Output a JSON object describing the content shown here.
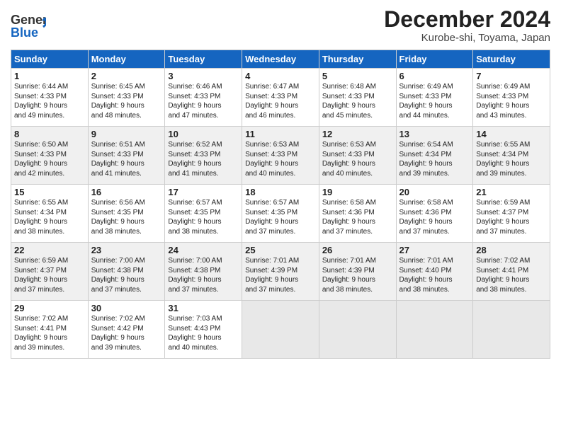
{
  "header": {
    "logo_general": "General",
    "logo_blue": "Blue",
    "title": "December 2024",
    "subtitle": "Kurobe-shi, Toyama, Japan"
  },
  "days_of_week": [
    "Sunday",
    "Monday",
    "Tuesday",
    "Wednesday",
    "Thursday",
    "Friday",
    "Saturday"
  ],
  "weeks": [
    [
      {
        "day": "1",
        "sunrise": "Sunrise: 6:44 AM",
        "sunset": "Sunset: 4:33 PM",
        "daylight": "Daylight: 9 hours and 49 minutes."
      },
      {
        "day": "2",
        "sunrise": "Sunrise: 6:45 AM",
        "sunset": "Sunset: 4:33 PM",
        "daylight": "Daylight: 9 hours and 48 minutes."
      },
      {
        "day": "3",
        "sunrise": "Sunrise: 6:46 AM",
        "sunset": "Sunset: 4:33 PM",
        "daylight": "Daylight: 9 hours and 47 minutes."
      },
      {
        "day": "4",
        "sunrise": "Sunrise: 6:47 AM",
        "sunset": "Sunset: 4:33 PM",
        "daylight": "Daylight: 9 hours and 46 minutes."
      },
      {
        "day": "5",
        "sunrise": "Sunrise: 6:48 AM",
        "sunset": "Sunset: 4:33 PM",
        "daylight": "Daylight: 9 hours and 45 minutes."
      },
      {
        "day": "6",
        "sunrise": "Sunrise: 6:49 AM",
        "sunset": "Sunset: 4:33 PM",
        "daylight": "Daylight: 9 hours and 44 minutes."
      },
      {
        "day": "7",
        "sunrise": "Sunrise: 6:49 AM",
        "sunset": "Sunset: 4:33 PM",
        "daylight": "Daylight: 9 hours and 43 minutes."
      }
    ],
    [
      {
        "day": "8",
        "sunrise": "Sunrise: 6:50 AM",
        "sunset": "Sunset: 4:33 PM",
        "daylight": "Daylight: 9 hours and 42 minutes."
      },
      {
        "day": "9",
        "sunrise": "Sunrise: 6:51 AM",
        "sunset": "Sunset: 4:33 PM",
        "daylight": "Daylight: 9 hours and 41 minutes."
      },
      {
        "day": "10",
        "sunrise": "Sunrise: 6:52 AM",
        "sunset": "Sunset: 4:33 PM",
        "daylight": "Daylight: 9 hours and 41 minutes."
      },
      {
        "day": "11",
        "sunrise": "Sunrise: 6:53 AM",
        "sunset": "Sunset: 4:33 PM",
        "daylight": "Daylight: 9 hours and 40 minutes."
      },
      {
        "day": "12",
        "sunrise": "Sunrise: 6:53 AM",
        "sunset": "Sunset: 4:33 PM",
        "daylight": "Daylight: 9 hours and 40 minutes."
      },
      {
        "day": "13",
        "sunrise": "Sunrise: 6:54 AM",
        "sunset": "Sunset: 4:34 PM",
        "daylight": "Daylight: 9 hours and 39 minutes."
      },
      {
        "day": "14",
        "sunrise": "Sunrise: 6:55 AM",
        "sunset": "Sunset: 4:34 PM",
        "daylight": "Daylight: 9 hours and 39 minutes."
      }
    ],
    [
      {
        "day": "15",
        "sunrise": "Sunrise: 6:55 AM",
        "sunset": "Sunset: 4:34 PM",
        "daylight": "Daylight: 9 hours and 38 minutes."
      },
      {
        "day": "16",
        "sunrise": "Sunrise: 6:56 AM",
        "sunset": "Sunset: 4:35 PM",
        "daylight": "Daylight: 9 hours and 38 minutes."
      },
      {
        "day": "17",
        "sunrise": "Sunrise: 6:57 AM",
        "sunset": "Sunset: 4:35 PM",
        "daylight": "Daylight: 9 hours and 38 minutes."
      },
      {
        "day": "18",
        "sunrise": "Sunrise: 6:57 AM",
        "sunset": "Sunset: 4:35 PM",
        "daylight": "Daylight: 9 hours and 37 minutes."
      },
      {
        "day": "19",
        "sunrise": "Sunrise: 6:58 AM",
        "sunset": "Sunset: 4:36 PM",
        "daylight": "Daylight: 9 hours and 37 minutes."
      },
      {
        "day": "20",
        "sunrise": "Sunrise: 6:58 AM",
        "sunset": "Sunset: 4:36 PM",
        "daylight": "Daylight: 9 hours and 37 minutes."
      },
      {
        "day": "21",
        "sunrise": "Sunrise: 6:59 AM",
        "sunset": "Sunset: 4:37 PM",
        "daylight": "Daylight: 9 hours and 37 minutes."
      }
    ],
    [
      {
        "day": "22",
        "sunrise": "Sunrise: 6:59 AM",
        "sunset": "Sunset: 4:37 PM",
        "daylight": "Daylight: 9 hours and 37 minutes."
      },
      {
        "day": "23",
        "sunrise": "Sunrise: 7:00 AM",
        "sunset": "Sunset: 4:38 PM",
        "daylight": "Daylight: 9 hours and 37 minutes."
      },
      {
        "day": "24",
        "sunrise": "Sunrise: 7:00 AM",
        "sunset": "Sunset: 4:38 PM",
        "daylight": "Daylight: 9 hours and 37 minutes."
      },
      {
        "day": "25",
        "sunrise": "Sunrise: 7:01 AM",
        "sunset": "Sunset: 4:39 PM",
        "daylight": "Daylight: 9 hours and 37 minutes."
      },
      {
        "day": "26",
        "sunrise": "Sunrise: 7:01 AM",
        "sunset": "Sunset: 4:39 PM",
        "daylight": "Daylight: 9 hours and 38 minutes."
      },
      {
        "day": "27",
        "sunrise": "Sunrise: 7:01 AM",
        "sunset": "Sunset: 4:40 PM",
        "daylight": "Daylight: 9 hours and 38 minutes."
      },
      {
        "day": "28",
        "sunrise": "Sunrise: 7:02 AM",
        "sunset": "Sunset: 4:41 PM",
        "daylight": "Daylight: 9 hours and 38 minutes."
      }
    ],
    [
      {
        "day": "29",
        "sunrise": "Sunrise: 7:02 AM",
        "sunset": "Sunset: 4:41 PM",
        "daylight": "Daylight: 9 hours and 39 minutes."
      },
      {
        "day": "30",
        "sunrise": "Sunrise: 7:02 AM",
        "sunset": "Sunset: 4:42 PM",
        "daylight": "Daylight: 9 hours and 39 minutes."
      },
      {
        "day": "31",
        "sunrise": "Sunrise: 7:03 AM",
        "sunset": "Sunset: 4:43 PM",
        "daylight": "Daylight: 9 hours and 40 minutes."
      },
      null,
      null,
      null,
      null
    ]
  ]
}
